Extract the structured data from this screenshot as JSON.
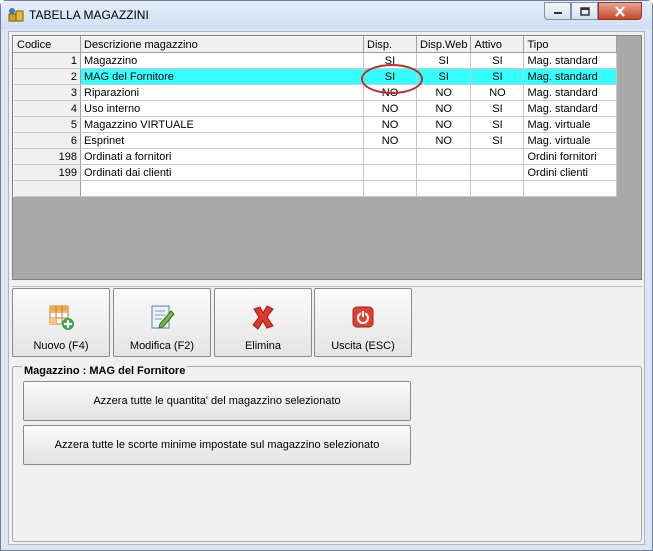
{
  "window": {
    "title": "TABELLA MAGAZZINI"
  },
  "grid": {
    "columns": [
      "Codice",
      "Descrizione magazzino",
      "Disp.",
      "Disp.Web",
      "Attivo",
      "Tipo"
    ],
    "rows": [
      {
        "code": "1",
        "desc": "Magazzino",
        "disp": "SI",
        "web": "SI",
        "active": "SI",
        "type": "Mag. standard"
      },
      {
        "code": "2",
        "desc": "MAG del Fornitore",
        "disp": "SI",
        "web": "SI",
        "active": "SI",
        "type": "Mag. standard"
      },
      {
        "code": "3",
        "desc": "Riparazioni",
        "disp": "NO",
        "web": "NO",
        "active": "NO",
        "type": "Mag. standard"
      },
      {
        "code": "4",
        "desc": "Uso interno",
        "disp": "NO",
        "web": "NO",
        "active": "SI",
        "type": "Mag. standard"
      },
      {
        "code": "5",
        "desc": "Magazzino VIRTUALE",
        "disp": "NO",
        "web": "NO",
        "active": "SI",
        "type": "Mag. virtuale"
      },
      {
        "code": "6",
        "desc": "Esprinet",
        "disp": "NO",
        "web": "NO",
        "active": "SI",
        "type": "Mag. virtuale"
      },
      {
        "code": "198",
        "desc": "Ordinati a fornitori",
        "disp": "",
        "web": "",
        "active": "",
        "type": "Ordini fornitori"
      },
      {
        "code": "199",
        "desc": "Ordinati dai clienti",
        "disp": "",
        "web": "",
        "active": "",
        "type": "Ordini clienti"
      },
      {
        "code": "",
        "desc": "",
        "disp": "",
        "web": "",
        "active": "",
        "type": ""
      }
    ],
    "selected_row": 1,
    "highlight_color": "#33ffff"
  },
  "toolbar": {
    "new_label": "Nuovo (F4)",
    "edit_label": "Modifica (F2)",
    "delete_label": "Elimina",
    "exit_label": "Uscita (ESC)"
  },
  "group": {
    "title": "Magazzino : MAG del Fornitore",
    "reset_qty_label": "Azzera tutte le quantita' del magazzino selezionato",
    "reset_min_label": "Azzera tutte le scorte minime impostate sul magazzino selezionato"
  },
  "icons": {
    "app": "warehouse-icon",
    "new": "add-grid-icon",
    "edit": "edit-document-icon",
    "delete": "red-x-icon",
    "exit": "power-icon"
  }
}
